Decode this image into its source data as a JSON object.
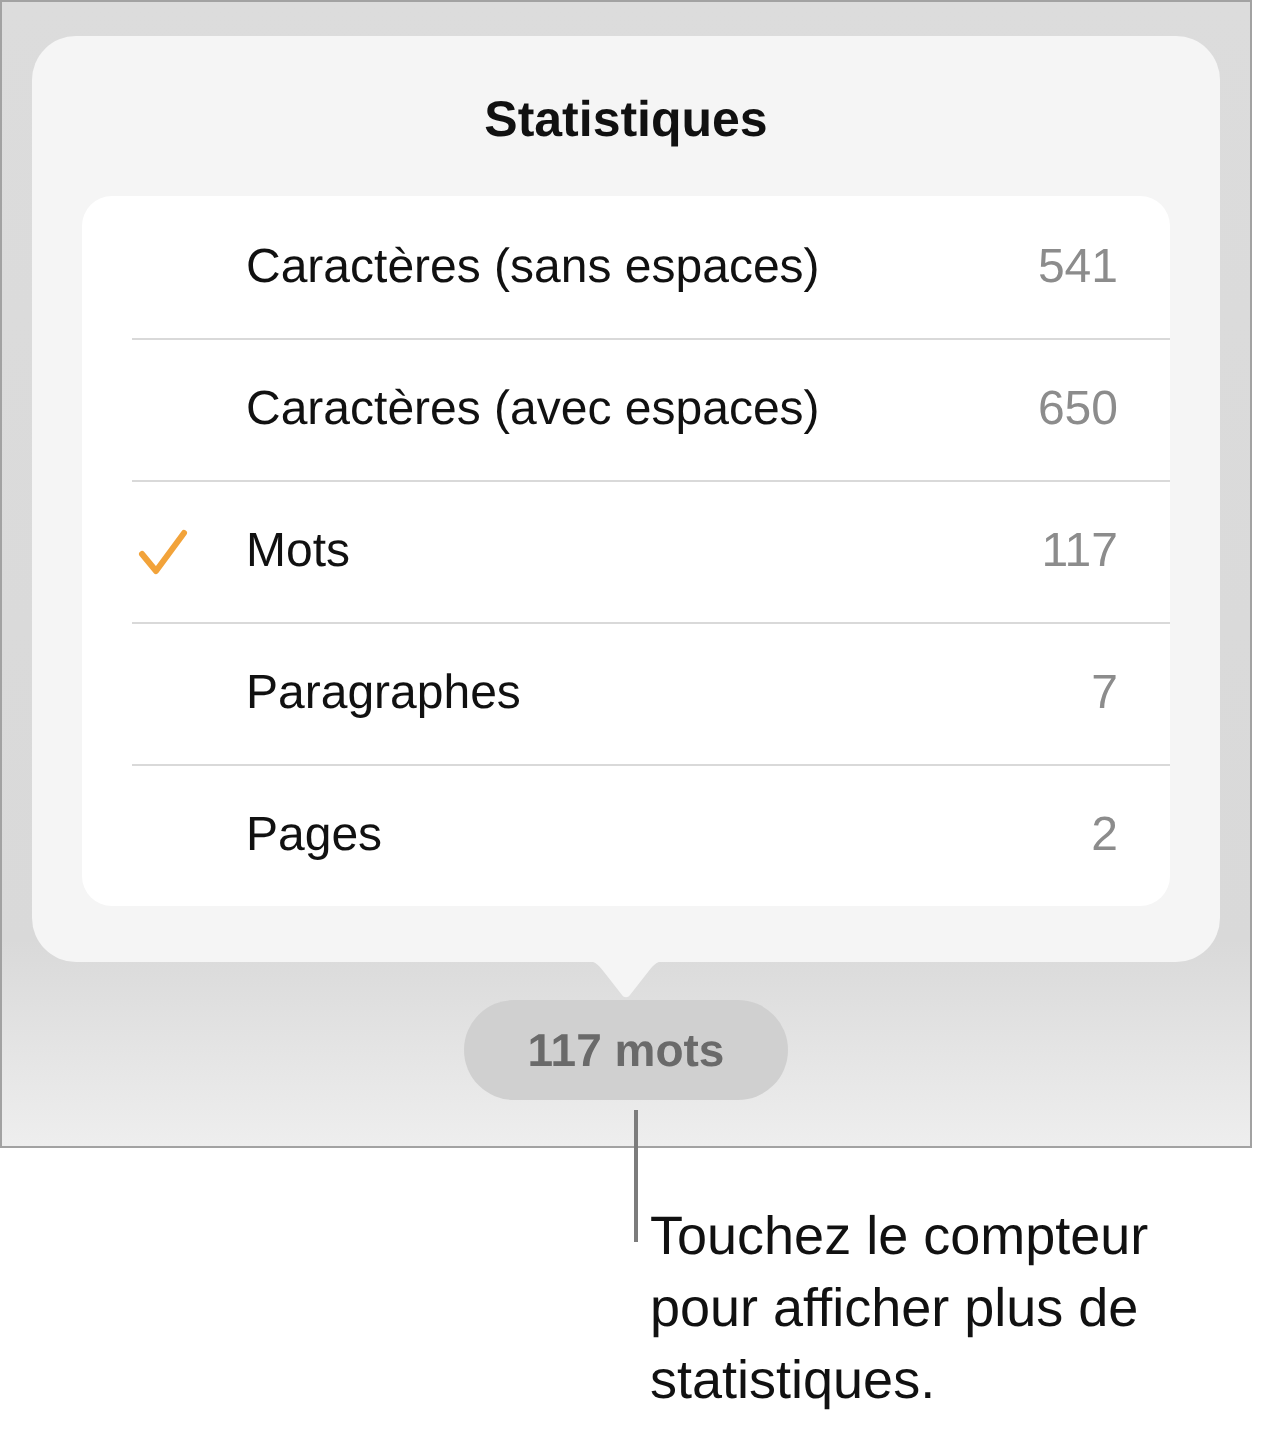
{
  "popover": {
    "title": "Statistiques",
    "rows": [
      {
        "label": "Caractères (sans espaces)",
        "value": "541",
        "selected": false
      },
      {
        "label": "Caractères (avec espaces)",
        "value": "650",
        "selected": false
      },
      {
        "label": "Mots",
        "value": "117",
        "selected": true
      },
      {
        "label": "Paragraphes",
        "value": "7",
        "selected": false
      },
      {
        "label": "Pages",
        "value": "2",
        "selected": false
      }
    ]
  },
  "counter": {
    "label": "117 mots"
  },
  "callout": {
    "text": "Touchez le compteur pour afficher plus de statistiques."
  }
}
